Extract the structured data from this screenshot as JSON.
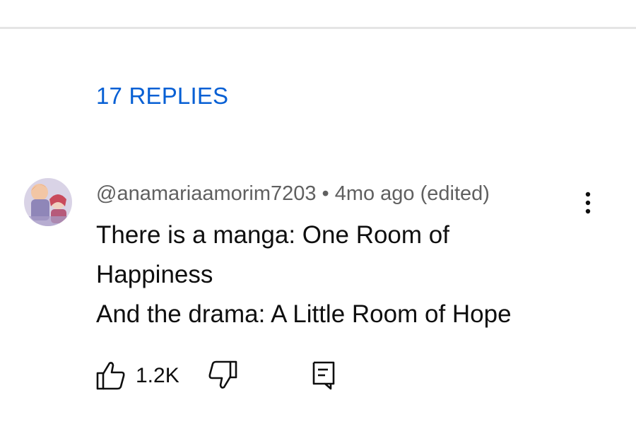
{
  "replies": {
    "label": "17 REPLIES"
  },
  "comment": {
    "author_handle": "@anamariaamorim7203",
    "separator": "•",
    "timestamp": "4mo ago (edited)",
    "text_lines": [
      "There is a manga: One Room of",
      "Happiness",
      "And the drama: A Little Room of Hope"
    ],
    "like_count": "1.2K"
  },
  "icons": {
    "like": "thumbs-up-icon",
    "dislike": "thumbs-down-icon",
    "reply": "reply-comment-icon",
    "more": "more-vert-icon"
  },
  "colors": {
    "link": "#065fd4",
    "meta": "#606060",
    "text": "#0f0f0f",
    "divider": "#e5e5e5"
  }
}
